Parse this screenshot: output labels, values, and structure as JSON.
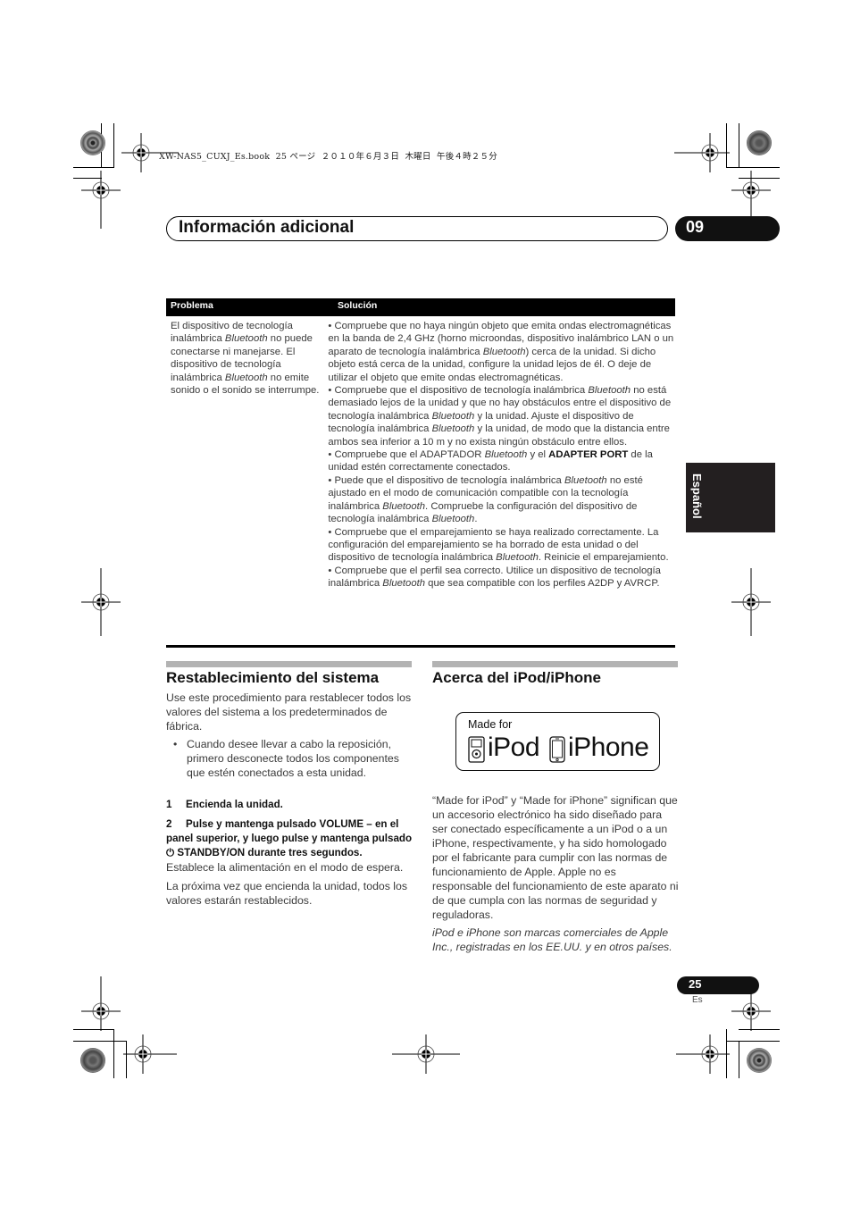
{
  "print_header": {
    "book_line": "XW-NAS5_CUXJ_Es.book  25 ページ  ２０１０年６月３日  木曜日  午後４時２５分"
  },
  "chapter": {
    "title": "Información adicional",
    "number": "09"
  },
  "side_tab": {
    "language": "Español"
  },
  "troubleshooting_table": {
    "headers": [
      "Problema",
      "Solución"
    ],
    "rows": [
      {
        "problem": "El dispositivo de tecnología inalámbrica Bluetooth no puede conectarse ni manejarse. El dispositivo de tecnología inalámbrica Bluetooth no emite sonido o el sonido se interrumpe.",
        "solutions": [
          "• Compruebe que no haya ningún objeto que emita ondas electromagnéticas en la banda de 2,4 GHz (horno microondas, dispositivo inalámbrico LAN o un aparato de tecnología inalámbrica Bluetooth) cerca de la unidad. Si dicho objeto está cerca de la unidad, configure la unidad lejos de él. O deje de utilizar el objeto que emite ondas electromagnéticas.",
          "• Compruebe que el dispositivo de tecnología inalámbrica Bluetooth no está demasiado lejos de la unidad y que no hay obstáculos entre el dispositivo de tecnología inalámbrica Bluetooth y la unidad. Ajuste el dispositivo de tecnología inalámbrica Bluetooth y la unidad, de modo que la distancia entre ambos sea inferior a 10 m y no exista ningún obstáculo entre ellos.",
          "• Compruebe que el ADAPTADOR Bluetooth y el ADAPTER PORT de la unidad estén correctamente conectados.",
          "• Puede que el dispositivo de tecnología inalámbrica Bluetooth no esté ajustado en el modo de comunicación compatible con la tecnología inalámbrica Bluetooth. Compruebe la configuración del dispositivo de tecnología inalámbrica Bluetooth.",
          "• Compruebe que el emparejamiento se haya realizado correctamente. La configuración del emparejamiento se ha borrado de esta unidad o del dispositivo de tecnología inalámbrica Bluetooth. Reinicie el emparejamiento.",
          "• Compruebe que el perfil sea correcto. Utilice un dispositivo de tecnología inalámbrica Bluetooth que sea compatible con los perfiles A2DP y AVRCP."
        ]
      }
    ]
  },
  "reset_section": {
    "title": "Restablecimiento del sistema",
    "intro": "Use este procedimiento para restablecer todos los valores del sistema a los predeterminados de fábrica.",
    "bullet": "Cuando desee llevar a cabo la reposición, primero desconecte todos los componentes que estén conectados a esta unidad.",
    "step1_num": "1",
    "step1": "Encienda la unidad.",
    "step2_num": "2",
    "step2": "Pulse y mantenga pulsado VOLUME – en el panel superior, y luego pulse y mantenga pulsado ⏻ STANDBY/ON durante tres segundos.",
    "step2_note": "Establece la alimentación en el modo de espera.",
    "outro": "La próxima vez que encienda la unidad, todos los valores estarán restablecidos."
  },
  "ipod_section": {
    "title": "Acerca del iPod/iPhone",
    "badge_made_for": "Made for",
    "badge_ipod": "iPod",
    "badge_iphone": "iPhone",
    "body": "“Made for iPod” y “Made for iPhone” significan que un accesorio electrónico ha sido diseñado para ser conectado específicamente a un iPod o a un iPhone, respectivamente, y ha sido homologado por el fabricante para cumplir con las normas de funcionamiento de Apple. Apple no es responsable del funcionamiento de este aparato ni de que cumpla con las normas de seguridad y reguladoras.",
    "trademark": "iPod e iPhone son marcas comerciales de Apple Inc., registradas en los EE.UU. y en otros países."
  },
  "footer": {
    "page_number": "25",
    "language_code": "Es"
  }
}
